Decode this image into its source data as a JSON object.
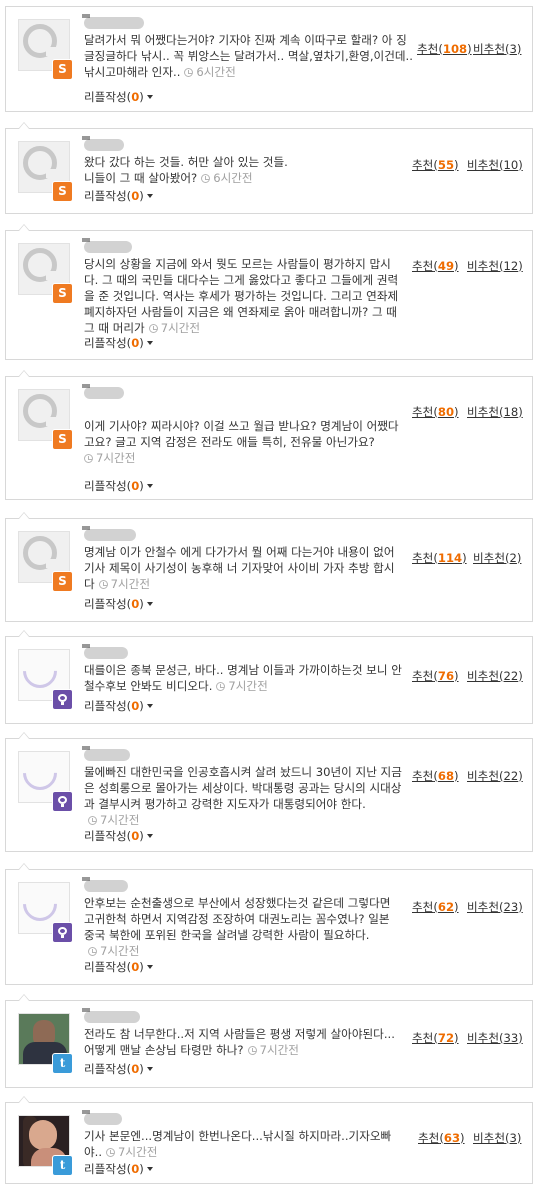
{
  "labels": {
    "recommend": "추천",
    "not_recommend": "비추천",
    "reply_write": "리플작성"
  },
  "colors": {
    "count_orange": "#ef6c00",
    "badge_s": "#ef7a21",
    "badge_d": "#6b4fa8",
    "badge_t": "#3a9bd9"
  },
  "comments": [
    {
      "avatar": "default-avatar",
      "badge": "S",
      "text": "달려가서 뭐 어쨌다는거야? 기자야 진짜 계속 이따구로 할래? 아 징글징글하다 낚시.. 꼭 뷔앙스는 달려가서.. 멱살,옆차기,환영,이건데.. 낚시고마해라 인자..",
      "time": "6시간전",
      "replies": "0",
      "up": "108",
      "down": "3"
    },
    {
      "avatar": "default-avatar",
      "badge": "S",
      "text": "왔다 갔다 하는 것들. 허만 살아 있는 것들. 니들이 그 때 살아봤어?",
      "time": "6시간전",
      "replies": "0",
      "up": "55",
      "down": "10"
    },
    {
      "avatar": "default-avatar",
      "badge": "S",
      "text": "당시의 상황을 지금에 와서 뭣도 모르는 사람들이 평가하지 맙시다. 그 때의 국민들 대다수는 그게 옳았다고 좋다고 그들에게 권력을 준 것입니다. 역사는 후세가 평가하는 것입니다. 그리고 연좌제 폐지하자던 사람들이 지금은 왜 연좌제로 옭아 매려합니까? 그 때 그 때 머리가",
      "time": "7시간전",
      "replies": "0",
      "up": "49",
      "down": "12"
    },
    {
      "avatar": "default-avatar",
      "badge": "S",
      "text": "이게 기사야? 찌라시야?\n이걸 쓰고 월급 받나요?\n명계남이 어쨌다고요?\n글고 지역 감정은 전라도 애들 특히, 전유물 아닌가요?",
      "time": "7시간전",
      "replies": "0",
      "up": "80",
      "down": "18"
    },
    {
      "avatar": "default-avatar",
      "badge": "S",
      "text": "명계남 이가 안철수 에게 다가가서 뭘 어째 다는거야 내용이 없어 기사 제목이 사기성이 농후해 너 기자맞어 사이비 가자 추방 합시다",
      "time": "7시간전",
      "replies": "0",
      "up": "114",
      "down": "2"
    },
    {
      "avatar": "daum-avatar",
      "badge": "D",
      "text": "대를이은 종북 문성근, 바다.. 명계남 이들과 가까이하는것 보니 안철수후보 안봐도 비디오다.",
      "time": "7시간전",
      "replies": "0",
      "up": "76",
      "down": "22"
    },
    {
      "avatar": "daum-avatar",
      "badge": "D",
      "text": "물에빠진 대한민국을 인공호흡시켜 살려 놨드니 30년이 지난 지금은 성희롱으로 몰아가는 세상이다. 박대통령 공과는 당시의 시대상과 결부시켜 평가하고 강력한 지도자가 대통령되어야 한다.",
      "time": "7시간전",
      "replies": "0",
      "up": "68",
      "down": "22"
    },
    {
      "avatar": "daum-avatar",
      "badge": "D",
      "text": "안후보는 순천출생으로 부산에서 성장했다는것 같은데 그렇다면 고귀한척 하면서 지역감정 조장하여 대권노리는 꼼수였나? 일본 중국 북한에 포위된 한국을 살려낼 강력한 사람이 필요하다.",
      "time": "7시간전",
      "replies": "0",
      "up": "62",
      "down": "23"
    },
    {
      "avatar": "photo-avatar",
      "badge": "t",
      "text": "전라도 참 너무한다..저 지역 사람들은 평생 저렇게 살아야된다...어떻게 맨날 손상님 타령만 하나?",
      "time": "7시간전",
      "replies": "0",
      "up": "72",
      "down": "33"
    },
    {
      "avatar": "photo-avatar",
      "badge": "t",
      "text": "기사 본문엔...명계남이 한번나온다...낚시질 하지마라..기자오빠야..",
      "time": "7시간전",
      "replies": "0",
      "up": "63",
      "down": "3"
    }
  ]
}
